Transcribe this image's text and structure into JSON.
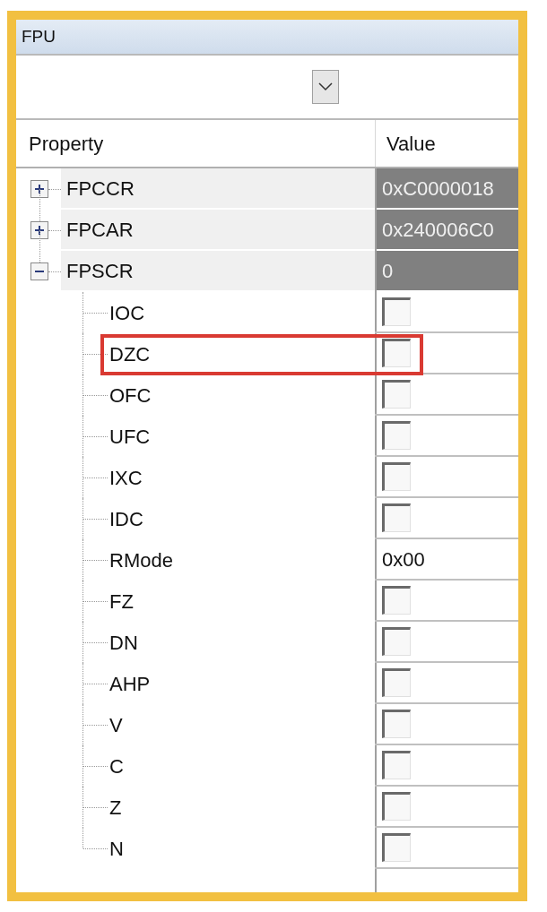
{
  "panel": {
    "title": "FPU"
  },
  "grid": {
    "columns": [
      "Property",
      "Value"
    ],
    "rows": [
      {
        "name": "FPCCR",
        "value": "0xC0000018",
        "expanded": false
      },
      {
        "name": "FPCAR",
        "value": "0x240006C0",
        "expanded": false
      },
      {
        "name": "FPSCR",
        "value": "0",
        "expanded": true,
        "children": [
          {
            "name": "IOC",
            "kind": "checkbox",
            "checked": false,
            "highlighted": false
          },
          {
            "name": "DZC",
            "kind": "checkbox",
            "checked": false,
            "highlighted": true
          },
          {
            "name": "OFC",
            "kind": "checkbox",
            "checked": false,
            "highlighted": false
          },
          {
            "name": "UFC",
            "kind": "checkbox",
            "checked": false,
            "highlighted": false
          },
          {
            "name": "IXC",
            "kind": "checkbox",
            "checked": false,
            "highlighted": false
          },
          {
            "name": "IDC",
            "kind": "checkbox",
            "checked": false,
            "highlighted": false
          },
          {
            "name": "RMode",
            "kind": "text",
            "value": "0x00",
            "highlighted": false
          },
          {
            "name": "FZ",
            "kind": "checkbox",
            "checked": false,
            "highlighted": false
          },
          {
            "name": "DN",
            "kind": "checkbox",
            "checked": false,
            "highlighted": false
          },
          {
            "name": "AHP",
            "kind": "checkbox",
            "checked": false,
            "highlighted": false
          },
          {
            "name": "V",
            "kind": "checkbox",
            "checked": false,
            "highlighted": false
          },
          {
            "name": "C",
            "kind": "checkbox",
            "checked": false,
            "highlighted": false
          },
          {
            "name": "Z",
            "kind": "checkbox",
            "checked": false,
            "highlighted": false
          },
          {
            "name": "N",
            "kind": "checkbox",
            "checked": false,
            "highlighted": false
          }
        ]
      }
    ]
  }
}
